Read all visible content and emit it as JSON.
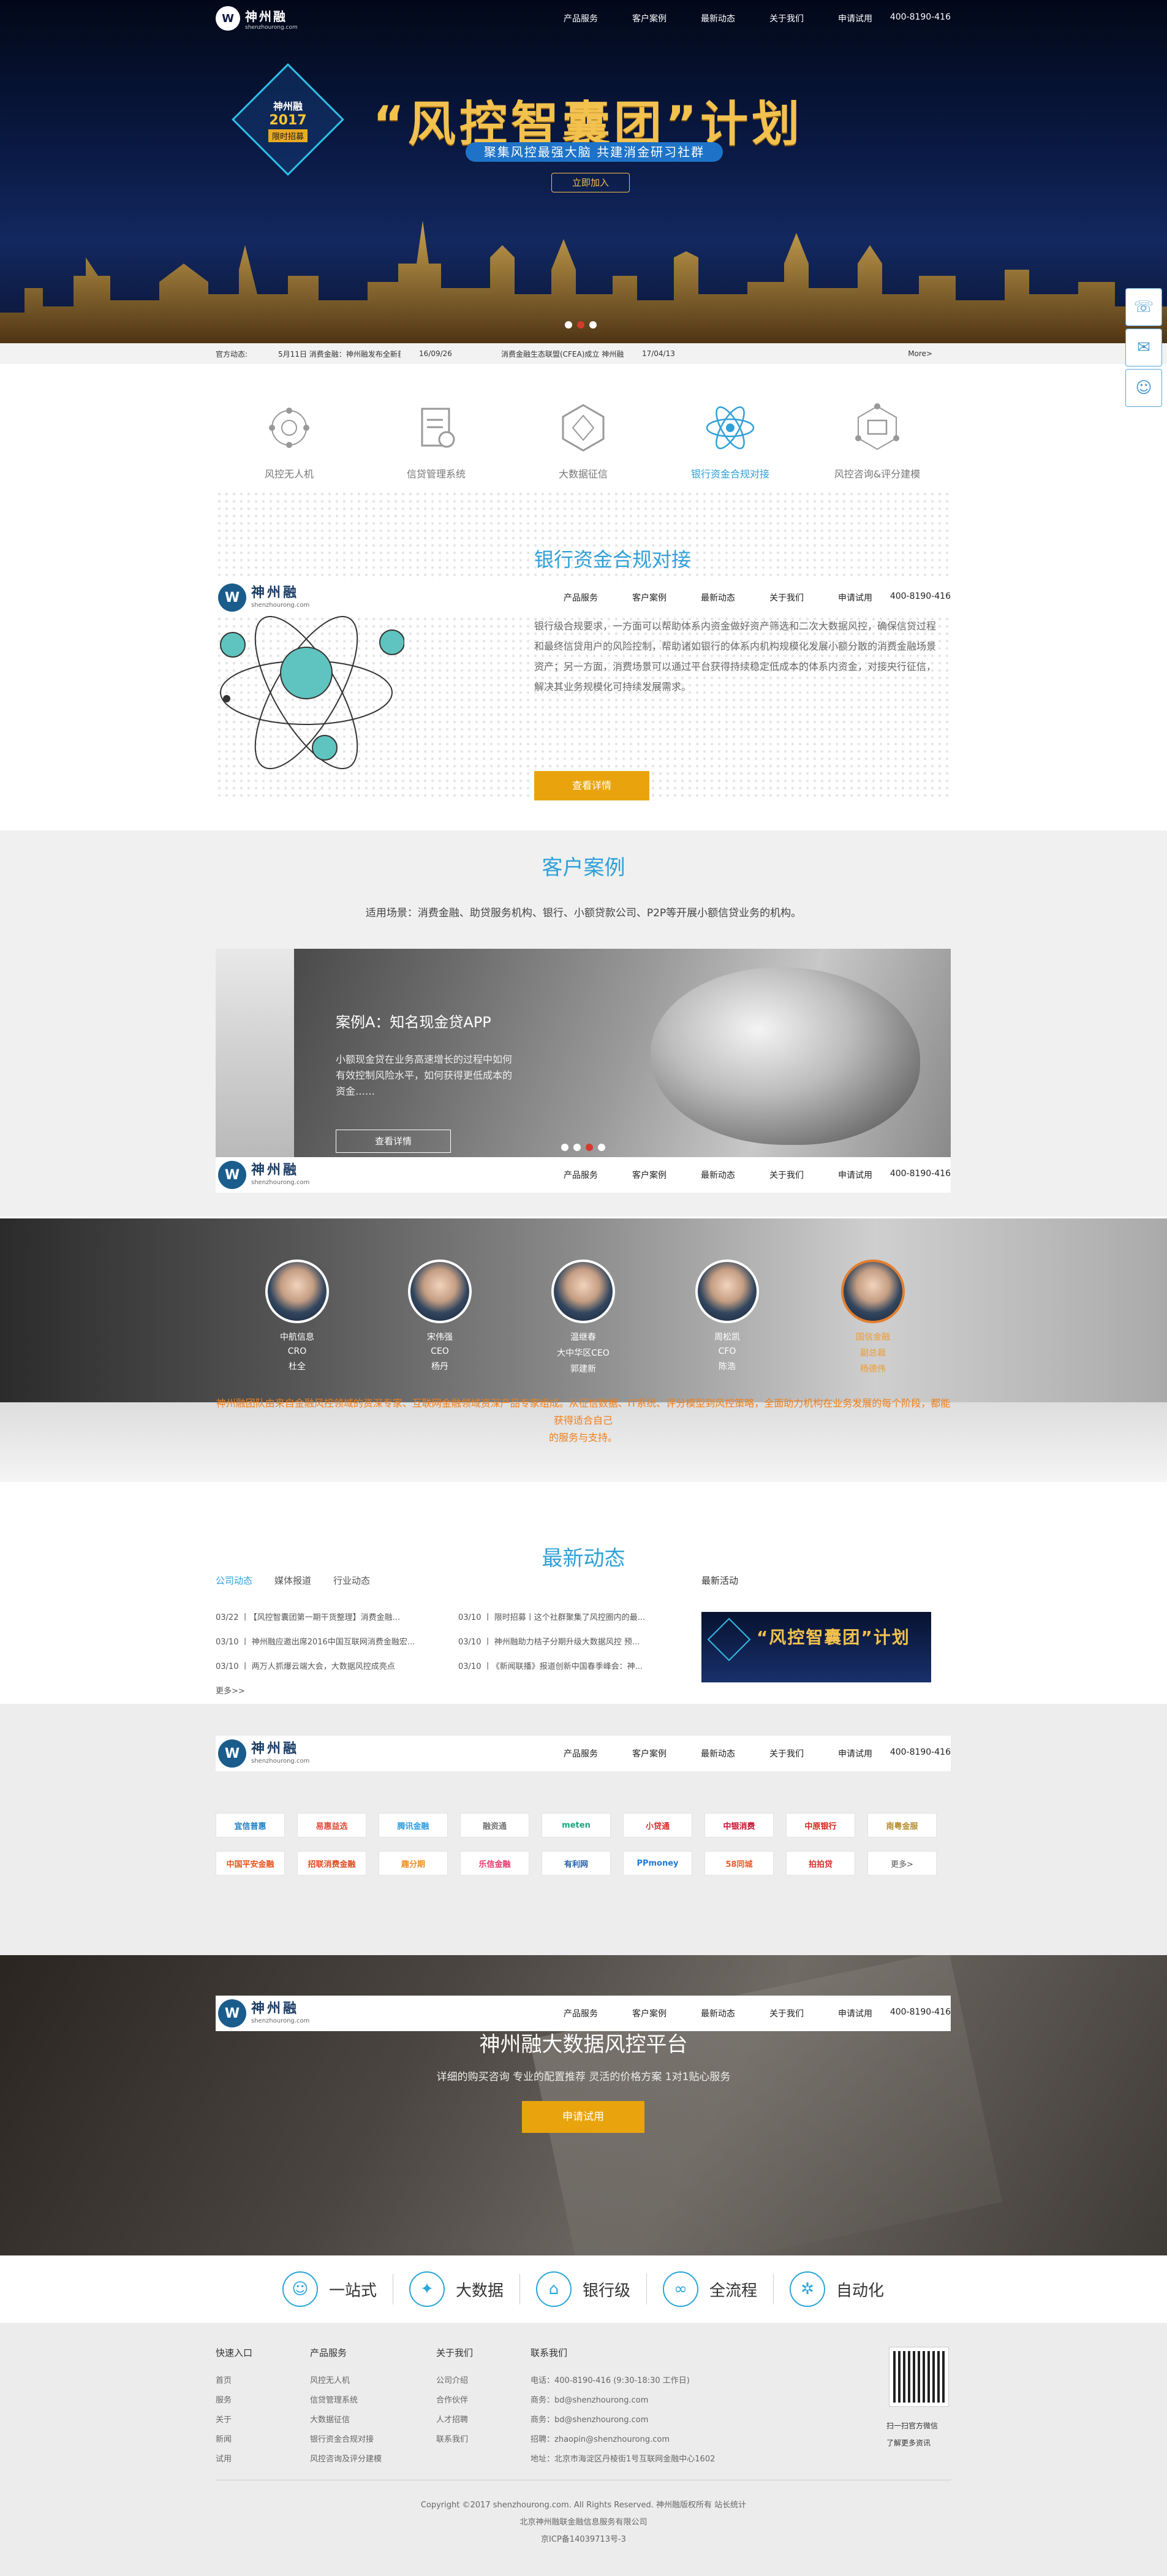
{
  "nav": {
    "logo_cn": "神州融",
    "logo_en": "shenzhourong.com",
    "items": [
      "产品服务",
      "客户案例",
      "最新动态",
      "关于我们",
      "申请试用"
    ],
    "phone": "400-8190-416"
  },
  "hero": {
    "badge_a": "神州融",
    "badge_b": "2017",
    "badge_c": "限时招募",
    "title": "“风控智囊团”计划",
    "subtitle": "聚集风控最强大脑 共建消金研习社群",
    "button": "立即加入"
  },
  "ticker": {
    "label": "官方动态:",
    "item1": "5月11日 消费金融：神州融发布全新获客产品：与...",
    "date1": "16/09/26",
    "item2": "消费金融生态联盟(CFEA)成立 神州融...",
    "date2": "17/04/13",
    "more": "More>"
  },
  "products": [
    {
      "label": "风控无人机"
    },
    {
      "label": "信贷管理系统"
    },
    {
      "label": "大数据征信"
    },
    {
      "label": "银行资金合规对接"
    },
    {
      "label": "风控咨询&评分建模"
    }
  ],
  "detail": {
    "title": "银行资金合规对接",
    "text": "银行级合规要求，一方面可以帮助体系内资金做好资产筛选和二次大数据风控，确保信贷过程和最终信贷用户的风险控制，帮助诸如银行的体系内机构规模化发展小额分散的消费金融场景资产；另一方面，消费场景可以通过平台获得持续稳定低成本的体系内资金，对接央行征信，解决其业务规模化可持续发展需求。",
    "button": "查看详情"
  },
  "cases": {
    "title": "客户案例",
    "subtitle": "适用场景：消费金融、助贷服务机构、银行、小额贷款公司、P2P等开展小额信贷业务的机构。",
    "case_title": "案例A：知名现金贷APP",
    "case_desc": "小额现金贷在业务高速增长的过程中如何有效控制风险水平，如何获得更低成本的资金……",
    "case_button": "查看详情"
  },
  "team": {
    "members": [
      {
        "name": "中航信息",
        "role1": "CRO",
        "role2": "杜全"
      },
      {
        "name": "宋伟强",
        "role1": "CEO",
        "role2": "杨丹"
      },
      {
        "name": "温继春",
        "role1": "大中华区CEO",
        "role2": "郭建新"
      },
      {
        "name": "周松凯",
        "role1": "CFO",
        "role2": "陈浩"
      },
      {
        "name": "国信金融",
        "role1": "副总裁",
        "role2": "杨德伟"
      }
    ],
    "text1": "神州融团队由来自金融风控领域的资深专家、互联网金融领域资深产品专家组成。从征信数据、IT系统、评分模型到风控策略，全面助力机构在业务发展的每个阶段，都能获得适合自己",
    "text2": "的服务与支持。"
  },
  "news": {
    "title": "最新动态",
    "tabs": [
      "公司动态",
      "媒体报道",
      "行业动态"
    ],
    "col1": [
      "03/22 丨【风控智囊团第一期干货整理】消费金融...",
      "03/10 丨 神州融应邀出席2016中国互联网消费金融宏...",
      "03/10 丨 两万人抓爆云端大会，大数据风控成亮点"
    ],
    "col2": [
      "03/10 丨 限时招募丨这个社群聚集了风控圈内的最...",
      "03/10 丨 神州融助力桔子分期升级大数据风控 预...",
      "03/10 丨《新闻联播》报道创新中国春季峰会：神..."
    ],
    "more": "更多>>",
    "event_title": "最新活动",
    "event_img_text": "“风控智囊团”计划"
  },
  "partners": {
    "logos": [
      "宜信普惠",
      "易惠益选",
      "腾讯金融",
      "融资通",
      "meten",
      "小贷通",
      "中银消费",
      "中原银行",
      "南粤金服",
      "中国平安金融",
      "招联消费金融",
      "趣分期",
      "乐信金融",
      "有利网",
      "PPmoney",
      "58同城",
      "拍拍贷",
      "更多>"
    ]
  },
  "cta": {
    "title": "神州融大数据风控平台",
    "subtitle": "详细的购买咨询 专业的配置推荐 灵活的价格方案 1对1贴心服务",
    "button": "申请试用"
  },
  "features": [
    "一站式",
    "大数据",
    "银行级",
    "全流程",
    "自动化"
  ],
  "footer": {
    "quick_title": "快速入口",
    "quick": [
      "首页",
      "服务",
      "关于",
      "新闻",
      "试用"
    ],
    "prod_title": "产品服务",
    "prod": [
      "风控无人机",
      "信贷管理系统",
      "大数据征信",
      "银行资金合规对接",
      "风控咨询及评分建模"
    ],
    "about_title": "关于我们",
    "about": [
      "公司介绍",
      "合作伙伴",
      "人才招聘",
      "联系我们"
    ],
    "contact_title": "联系我们",
    "contact": [
      "电话：400-8190-416 (9:30-18:30 工作日)",
      "商务：bd@shenzhourong.com",
      "商务：bd@shenzhourong.com",
      "招聘：zhaopin@shenzhourong.com",
      "地址：北京市海淀区丹棱街1号互联网金融中心1602"
    ],
    "qr1": "扫一扫官方微信",
    "qr2": "了解更多资讯",
    "copy1": "Copyright ©2017 shenzhourong.com. All Rights Reserved. 神州融版权所有 站长统计",
    "copy2": "北京神州融联金融信息服务有限公司",
    "copy3": "京ICP备14039713号-3"
  },
  "colors": {
    "accent": "#2fa0d8",
    "cta": "#e9a40d",
    "highlight": "#ef7f1a"
  }
}
